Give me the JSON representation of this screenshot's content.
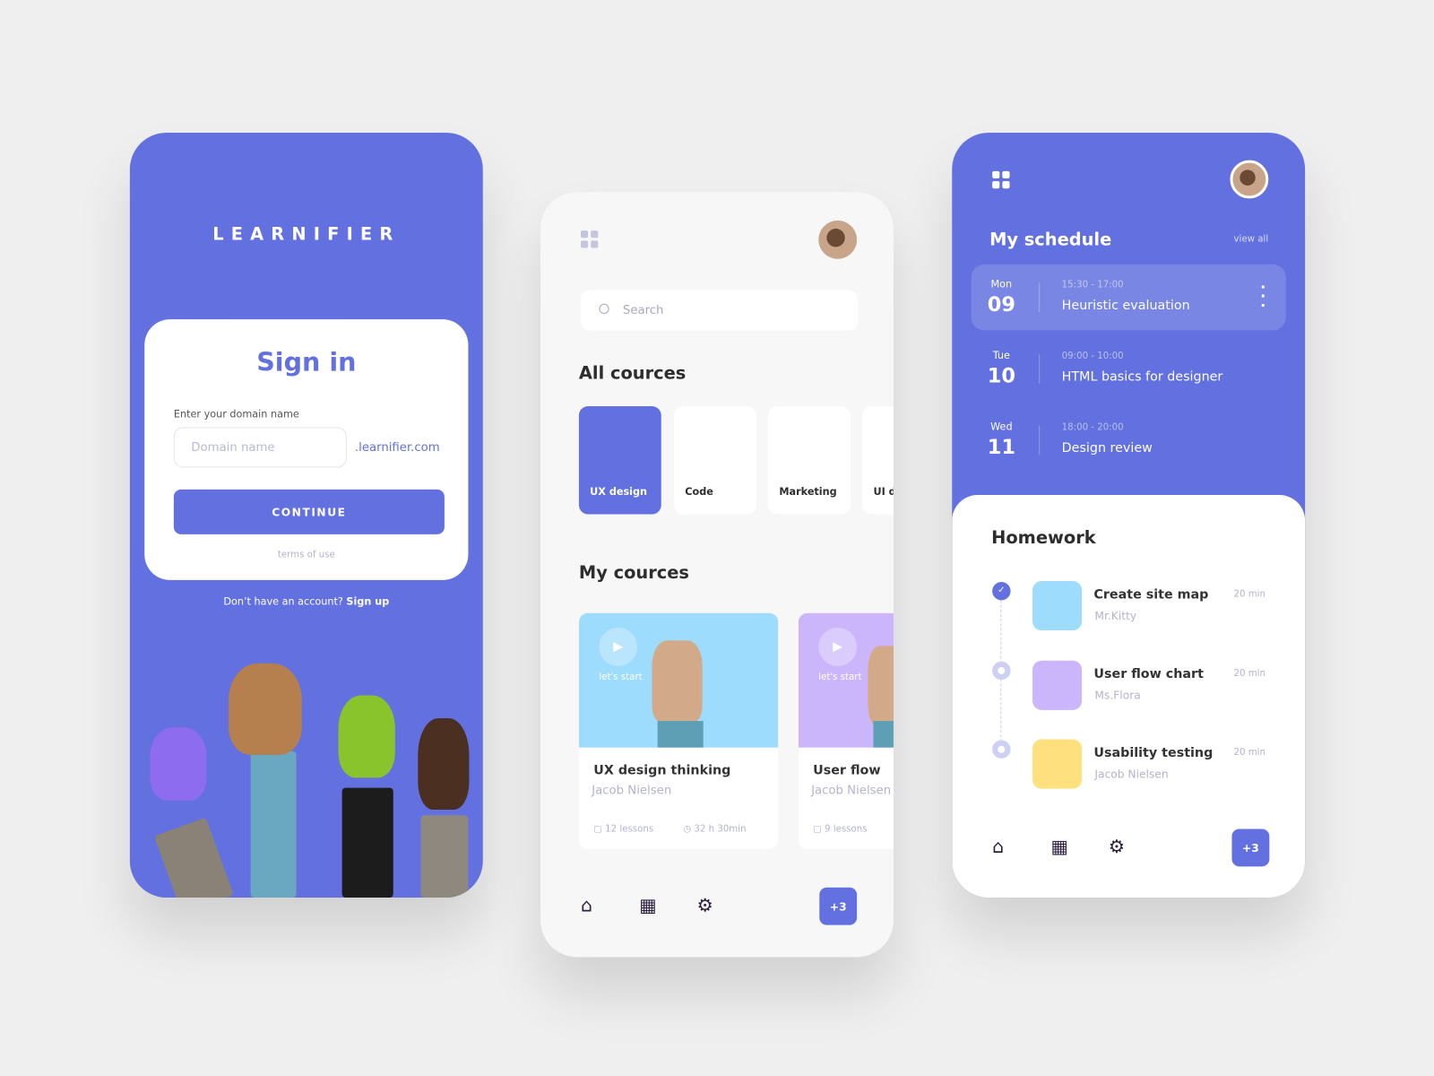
{
  "colors": {
    "accent": "#6271df",
    "background": "#efefef"
  },
  "signin": {
    "logo": "LEARNIFIER",
    "title": "Sign in",
    "domain_label": "Enter your domain name",
    "domain_placeholder": "Domain name",
    "domain_value": "",
    "domain_suffix": ".learnifier.com",
    "continue_label": "CONTINUE",
    "terms": "terms of use",
    "no_account": "Don’t have an account?",
    "signup": "Sign up"
  },
  "courses": {
    "menu_icon": "grid-icon",
    "search_placeholder": "Search",
    "all_title": "All cources",
    "categories": [
      {
        "label": "UX design",
        "active": true
      },
      {
        "label": "Code"
      },
      {
        "label": "Marketing"
      },
      {
        "label": "UI d"
      }
    ],
    "my_title": "My cources",
    "items": [
      {
        "tag": "let's start",
        "title": "UX design thinking",
        "author": "Jacob Nielsen",
        "lessons": "12 lessons",
        "duration": "32 h 30min",
        "color": "#9ddcfc"
      },
      {
        "tag": "let's start",
        "title": "User flow",
        "author": "Jacob Nielsen",
        "lessons": "9 lessons",
        "color": "#cbb6fb"
      }
    ],
    "nav": {
      "badge": "+3"
    }
  },
  "schedule": {
    "title": "My schedule",
    "view_all": "view all",
    "items": [
      {
        "day": "Mon",
        "date": "09",
        "time": "15:30 - 17:00",
        "title": "Heuristic evaluation",
        "active": true
      },
      {
        "day": "Tue",
        "date": "10",
        "time": "09:00 - 10:00",
        "title": "HTML basics for designer"
      },
      {
        "day": "Wed",
        "date": "11",
        "time": "18:00 - 20:00",
        "title": "Design review"
      }
    ],
    "homework_title": "Homework",
    "homework": [
      {
        "title": "Create site map",
        "author": "Mr.Kitty",
        "duration": "20 min",
        "done": true,
        "color": "#9ddcfc"
      },
      {
        "title": "User flow chart",
        "author": "Ms.Flora",
        "duration": "20 min",
        "done": false,
        "color": "#cbb6fb"
      },
      {
        "title": "Usability testing",
        "author": "Jacob Nielsen",
        "duration": "20 min",
        "done": false,
        "color": "#ffe07f"
      }
    ],
    "nav": {
      "badge": "+3"
    }
  }
}
